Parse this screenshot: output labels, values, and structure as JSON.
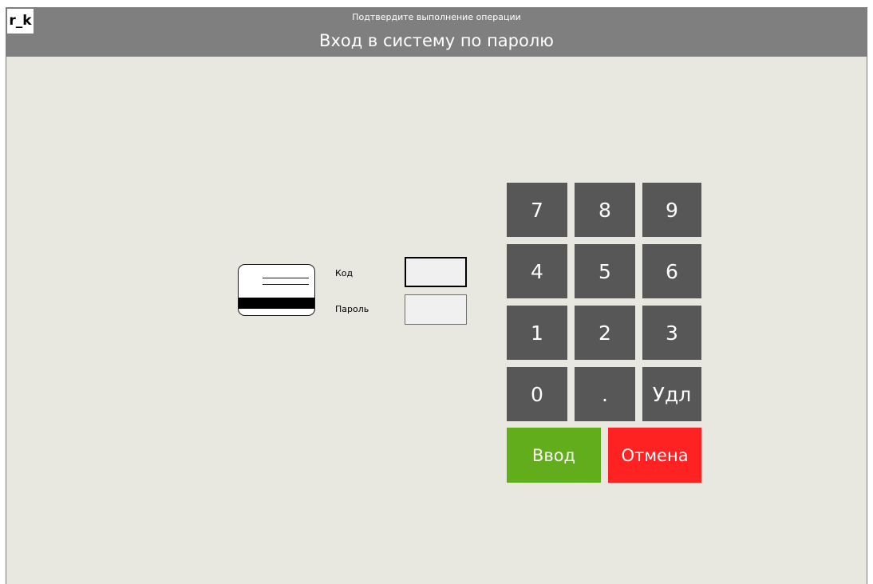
{
  "header": {
    "logo": "r_k",
    "subtitle": "Подтвердите выполнение операции",
    "title": "Вход в систему по паролю"
  },
  "form": {
    "card_icon": "magnetic-card-icon",
    "code_label": "Код",
    "code_value": "",
    "password_label": "Пароль",
    "password_value": ""
  },
  "keypad": {
    "keys": [
      "7",
      "8",
      "9",
      "4",
      "5",
      "6",
      "1",
      "2",
      "3",
      "0",
      ".",
      "Удл"
    ]
  },
  "actions": {
    "enter_label": "Ввод",
    "cancel_label": "Отмена"
  },
  "colors": {
    "titlebar": "#7f7f7f",
    "background": "#e8e7e0",
    "key": "#575757",
    "enter": "#62ad1c",
    "cancel": "#ff2222"
  }
}
